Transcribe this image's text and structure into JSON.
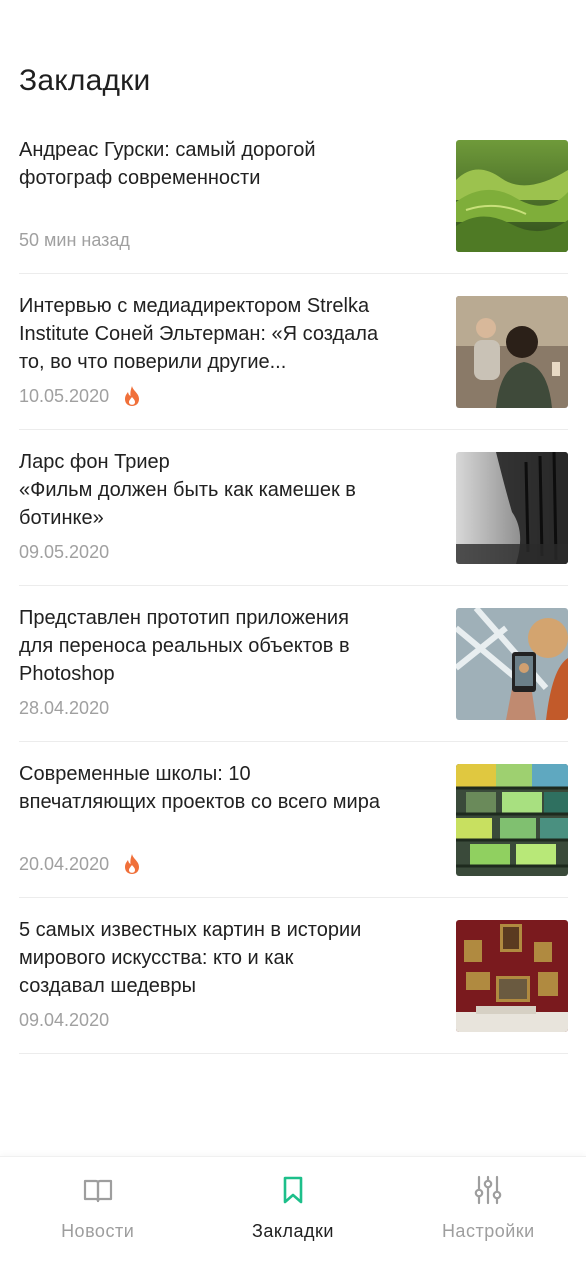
{
  "page": {
    "title": "Закладки"
  },
  "colors": {
    "accent": "#1dbf8a",
    "fire": "#f0703a",
    "meta": "#a0a0a0"
  },
  "articles": [
    {
      "title": "Андреас Гурски: самый дорогой\nфотограф современности",
      "date": "50 мин назад",
      "hot": false,
      "thumb": "green-hills-photo"
    },
    {
      "title": "Интервью с медиадиректором Strelka\nInstitute Соней Эльтерман: «Я создала\nто, во что поверили другие...",
      "date": "10.05.2020",
      "hot": true,
      "thumb": "people-in-cafe-photo"
    },
    {
      "title": "Ларс фон Триер\n«Фильм должен быть как камешек в\nботинке»",
      "date": "09.05.2020",
      "hot": false,
      "thumb": "foggy-trees-photo"
    },
    {
      "title": "Представлен прототип приложения\nдля переноса реальных объектов в\nPhotoshop",
      "date": "28.04.2020",
      "hot": false,
      "thumb": "phone-camera-photo"
    },
    {
      "title": "Современные школы: 10\nвпечатляющих проектов со всего мира",
      "date": "20.04.2020",
      "hot": true,
      "thumb": "colorful-building-photo"
    },
    {
      "title": "5 самых известных картин в истории\nмирового искусства: кто и как\nсоздавал шедевры",
      "date": "09.04.2020",
      "hot": false,
      "thumb": "museum-gallery-photo"
    }
  ],
  "nav": [
    {
      "label": "Новости",
      "icon": "book-icon",
      "active": false
    },
    {
      "label": "Закладки",
      "icon": "bookmark-icon",
      "active": true
    },
    {
      "label": "Настройки",
      "icon": "sliders-icon",
      "active": false
    }
  ]
}
